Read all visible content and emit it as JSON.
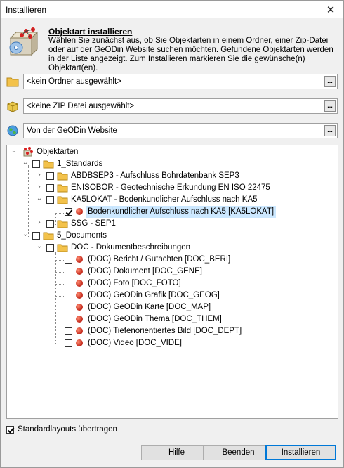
{
  "window": {
    "title": "Installieren"
  },
  "header": {
    "title": "Objektart installieren",
    "description": "Wählen Sie zunächst aus, ob Sie Objektarten in einem Ordner, einer Zip-Datei oder auf der GeODin Website suchen möchten. Gefundene Objektarten werden in der Liste angezeigt. Zum Installieren markieren Sie die gewünsche(n) Objektart(en)."
  },
  "sources": {
    "folder": {
      "value": "<kein Ordner ausgewählt>",
      "browse": "..."
    },
    "zip": {
      "value": "<keine ZIP Datei ausgewählt>",
      "browse": "..."
    },
    "web": {
      "value": "Von der GeODin Website",
      "browse": "..."
    }
  },
  "tree": {
    "root": "Objektarten",
    "standards": "1_Standards",
    "abdbsep3": "ABDBSEP3 - Aufschluss Bohrdatenbank SEP3",
    "enisobor": "ENISOBOR - Geotechnische Erkundung EN ISO 22475",
    "ka5lokat": "KA5LOKAT - Bodenkundlicher Aufschluss nach KA5",
    "ka5lokat_item": "Bodenkundlicher Aufschluss nach KA5 [KA5LOKAT]",
    "ssg": "SSG - SEP1",
    "documents": "5_Documents",
    "doc": "DOC - Dokumentbeschreibungen",
    "doc_items": [
      "(DOC) Bericht / Gutachten [DOC_BERI]",
      "(DOC) Dokument [DOC_GENE]",
      "(DOC) Foto [DOC_FOTO]",
      "(DOC) GeODin Grafik [DOC_GEOG]",
      "(DOC) GeODin Karte [DOC_MAP]",
      "(DOC) GeODin Thema [DOC_THEM]",
      "(DOC) Tiefenorientiertes Bild [DOC_DEPT]",
      "(DOC) Video [DOC_VIDE]"
    ]
  },
  "footer": {
    "standard_layouts": "Standardlayouts übertragen",
    "buttons": {
      "help": "Hilfe",
      "cancel": "Beenden",
      "install": "Installieren"
    }
  },
  "colors": {
    "selection": "#cce8ff",
    "accent": "#0078d7",
    "folder": "#f3c24b",
    "item_dot": "#c1271a"
  }
}
